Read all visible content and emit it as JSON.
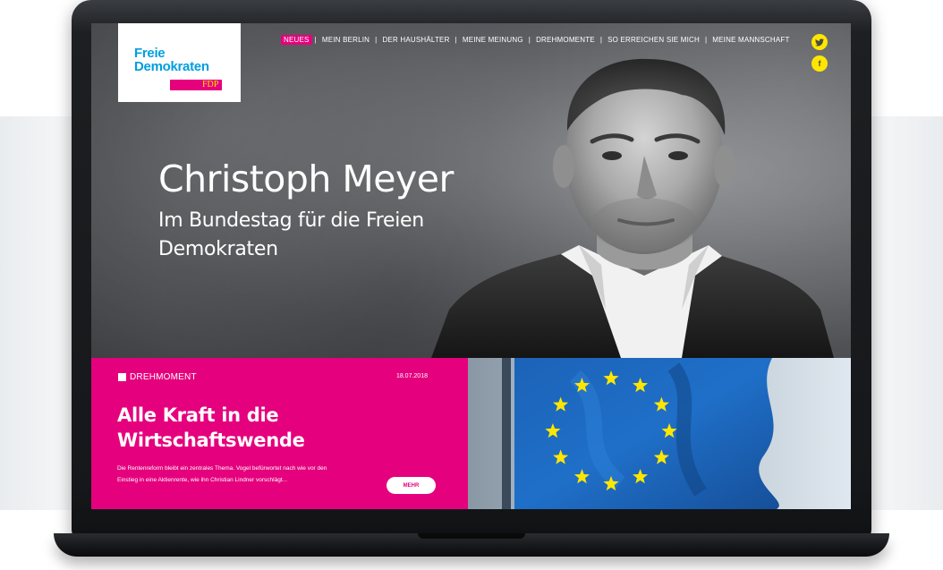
{
  "logo": {
    "line1": "Freie",
    "line2": "Demokraten",
    "badge": "FDP",
    "brand_blue": "#009ee0",
    "brand_magenta": "#e5007d",
    "brand_yellow": "#ffe600"
  },
  "nav": {
    "items": [
      {
        "label": "NEUES",
        "active": true
      },
      {
        "label": "MEIN BERLIN",
        "active": false
      },
      {
        "label": "DER HAUSHÄLTER",
        "active": false
      },
      {
        "label": "MEINE MEINUNG",
        "active": false
      },
      {
        "label": "DREHMOMENTE",
        "active": false
      },
      {
        "label": "SO ERREICHEN SIE MICH",
        "active": false
      },
      {
        "label": "MEINE MANNSCHAFT",
        "active": false
      }
    ],
    "separator": "|"
  },
  "social": {
    "twitter_icon": "twitter-icon",
    "facebook_icon": "facebook-icon",
    "facebook_glyph": "f"
  },
  "hero": {
    "title": "Christoph Meyer",
    "subtitle": "Im Bundestag für die Freien Demokraten"
  },
  "news": {
    "category": "DREHMOMENT",
    "date": "18.07.2018",
    "title": "Alle Kraft in die Wirtschaftswende",
    "text": "Die Rentenreform bleibt ein zentrales Thema. Vogel befürwortet nach wie vor den Einstieg in eine Aktienrente, wie ihn Christian Lindner vorschlägt...",
    "button": "MEHR"
  }
}
